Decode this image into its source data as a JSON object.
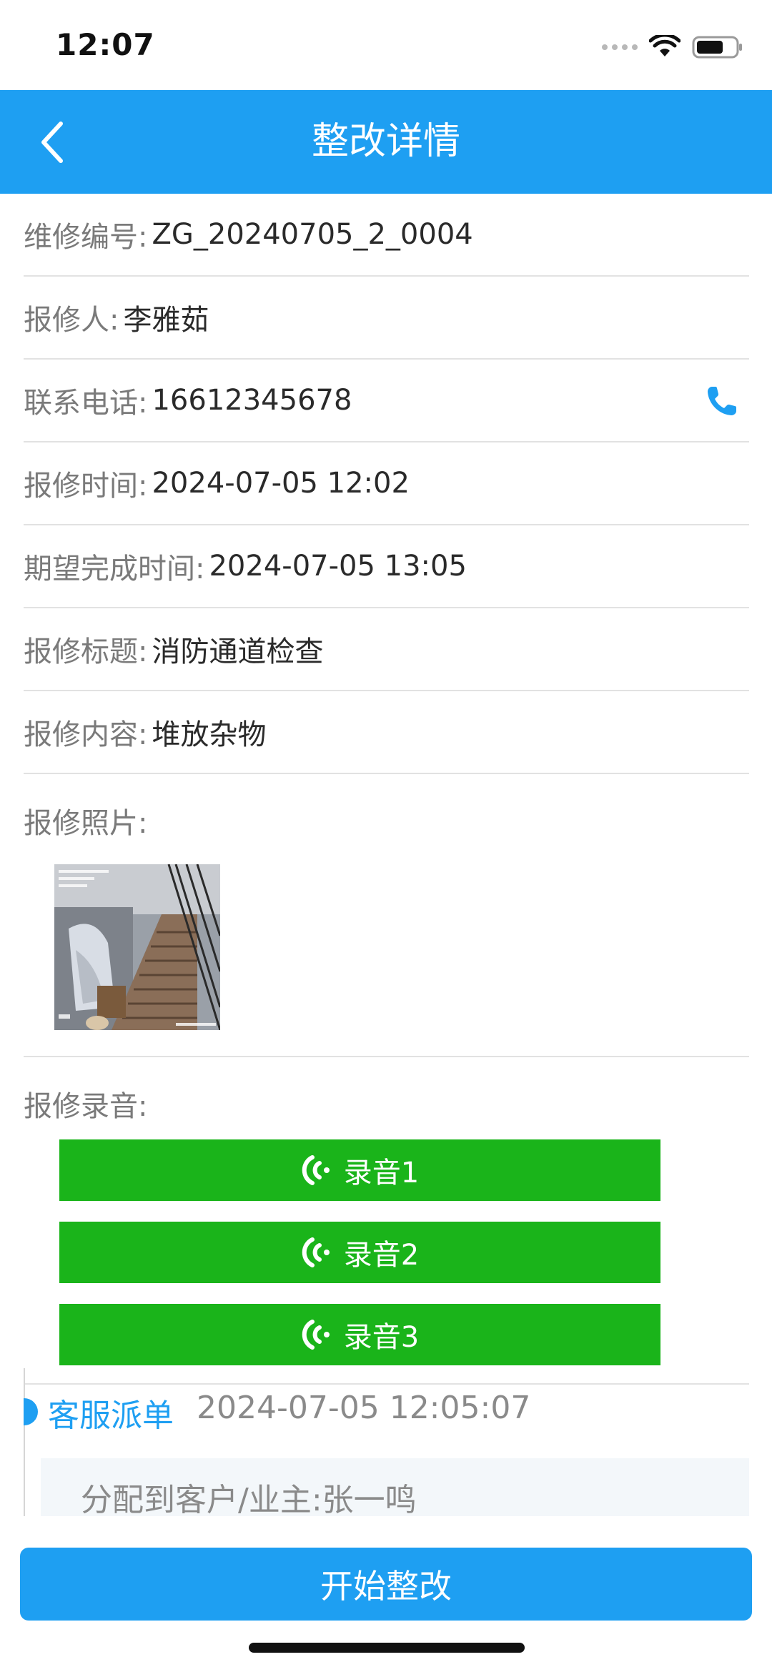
{
  "status_bar": {
    "time": "12:07"
  },
  "nav": {
    "title": "整改详情"
  },
  "fields": [
    {
      "label": "维修编号:",
      "value": "ZG_20240705_2_0004"
    },
    {
      "label": "报修人:",
      "value": "李雅茹"
    },
    {
      "label": "联系电话:",
      "value": "16612345678"
    },
    {
      "label": "报修时间:",
      "value": "2024-07-05 12:02"
    },
    {
      "label": "期望完成时间:",
      "value": "2024-07-05 13:05"
    },
    {
      "label": "报修标题:",
      "value": "消防通道检查"
    },
    {
      "label": "报修内容:",
      "value": "堆放杂物"
    }
  ],
  "photos": {
    "label": "报修照片:"
  },
  "audio": {
    "label": "报修录音:",
    "recordings": [
      "录音1",
      "录音2",
      "录音3"
    ]
  },
  "timeline": [
    {
      "type": "客服派单",
      "time": "2024-07-05 12:05:07",
      "detail": "分配到客户/业主:张一鸣"
    }
  ],
  "actions": {
    "start_label": "开始整改"
  },
  "colors": {
    "primary": "#1e9ff2",
    "audio_green": "#1ab41a"
  }
}
